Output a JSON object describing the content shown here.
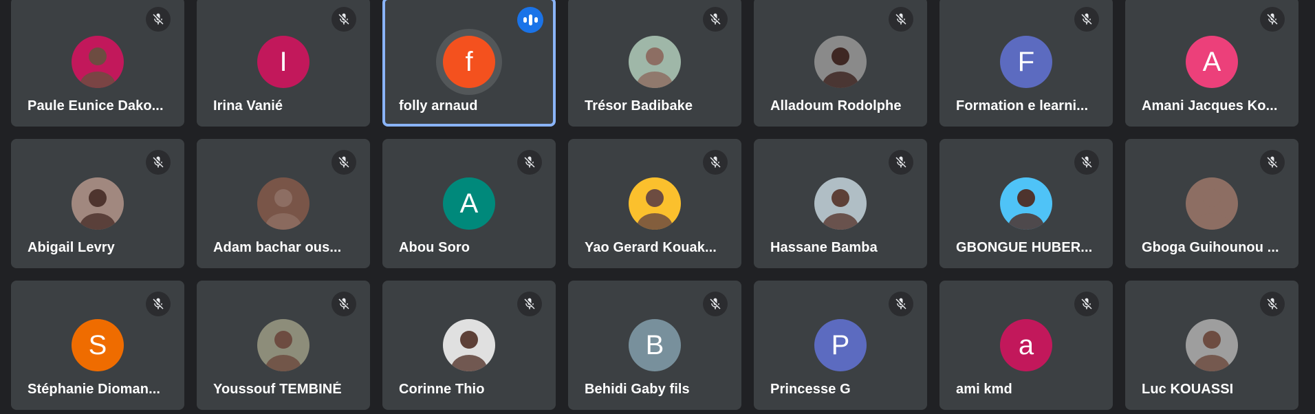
{
  "participants": [
    {
      "name": "Paule Eunice Dako...",
      "avatar_kind": "photo",
      "avatar_color": "#c2185b",
      "muted": true
    },
    {
      "name": "Irina Vanié",
      "avatar_kind": "letter",
      "initial": "I",
      "avatar_color": "#c2185b",
      "muted": true
    },
    {
      "name": "folly arnaud",
      "avatar_kind": "letter",
      "initial": "f",
      "avatar_color": "#f4511e",
      "muted": false,
      "speaking": true
    },
    {
      "name": "Trésor Badibake",
      "avatar_kind": "photo",
      "avatar_color": "#9fb7a8",
      "muted": true
    },
    {
      "name": "Alladoum Rodolphe",
      "avatar_kind": "photo",
      "avatar_color": "#8a8a8a",
      "muted": true
    },
    {
      "name": "Formation e learni...",
      "avatar_kind": "letter",
      "initial": "F",
      "avatar_color": "#5c6bc0",
      "muted": true
    },
    {
      "name": "Amani Jacques Ko...",
      "avatar_kind": "letter",
      "initial": "A",
      "avatar_color": "#ec407a",
      "muted": true
    },
    {
      "name": "Abigail Levry",
      "avatar_kind": "photo",
      "avatar_color": "#a1887f",
      "muted": true
    },
    {
      "name": "Adam bachar ous...",
      "avatar_kind": "photo",
      "avatar_color": "#795548",
      "muted": true
    },
    {
      "name": "Abou Soro",
      "avatar_kind": "letter",
      "initial": "A",
      "avatar_color": "#00897b",
      "muted": true
    },
    {
      "name": "Yao Gerard Kouak...",
      "avatar_kind": "photo",
      "avatar_color": "#fbc02d",
      "muted": true
    },
    {
      "name": "Hassane Bamba",
      "avatar_kind": "photo",
      "avatar_color": "#b0bec5",
      "muted": true
    },
    {
      "name": "GBONGUE HUBER...",
      "avatar_kind": "photo",
      "avatar_color": "#4fc3f7",
      "muted": true
    },
    {
      "name": "Gboga Guihounou ...",
      "avatar_kind": "photo",
      "avatar_color": "#8d6e63",
      "muted": true
    },
    {
      "name": "Stéphanie Dioman...",
      "avatar_kind": "letter",
      "initial": "S",
      "avatar_color": "#ef6c00",
      "muted": true
    },
    {
      "name": "Youssouf TEMBINÉ",
      "avatar_kind": "photo",
      "avatar_color": "#8d8d7a",
      "muted": true
    },
    {
      "name": "Corinne Thio",
      "avatar_kind": "photo",
      "avatar_color": "#e0e0e0",
      "muted": true
    },
    {
      "name": "Behidi Gaby fils",
      "avatar_kind": "letter",
      "initial": "B",
      "avatar_color": "#78909c",
      "muted": true
    },
    {
      "name": "Princesse G",
      "avatar_kind": "letter",
      "initial": "P",
      "avatar_color": "#5c6bc0",
      "muted": true
    },
    {
      "name": "ami kmd",
      "avatar_kind": "letter",
      "initial": "a",
      "avatar_color": "#c2185b",
      "muted": true
    },
    {
      "name": "Luc KOUASSI",
      "avatar_kind": "photo",
      "avatar_color": "#9e9e9e",
      "muted": true
    }
  ],
  "icons": {
    "mute": "mic-off-icon",
    "speaking": "audio-levels-icon"
  },
  "colors": {
    "background": "#202124",
    "tile": "#3c4043",
    "speaking_border": "#8ab4f8",
    "speaking_badge": "#1a73e8"
  }
}
